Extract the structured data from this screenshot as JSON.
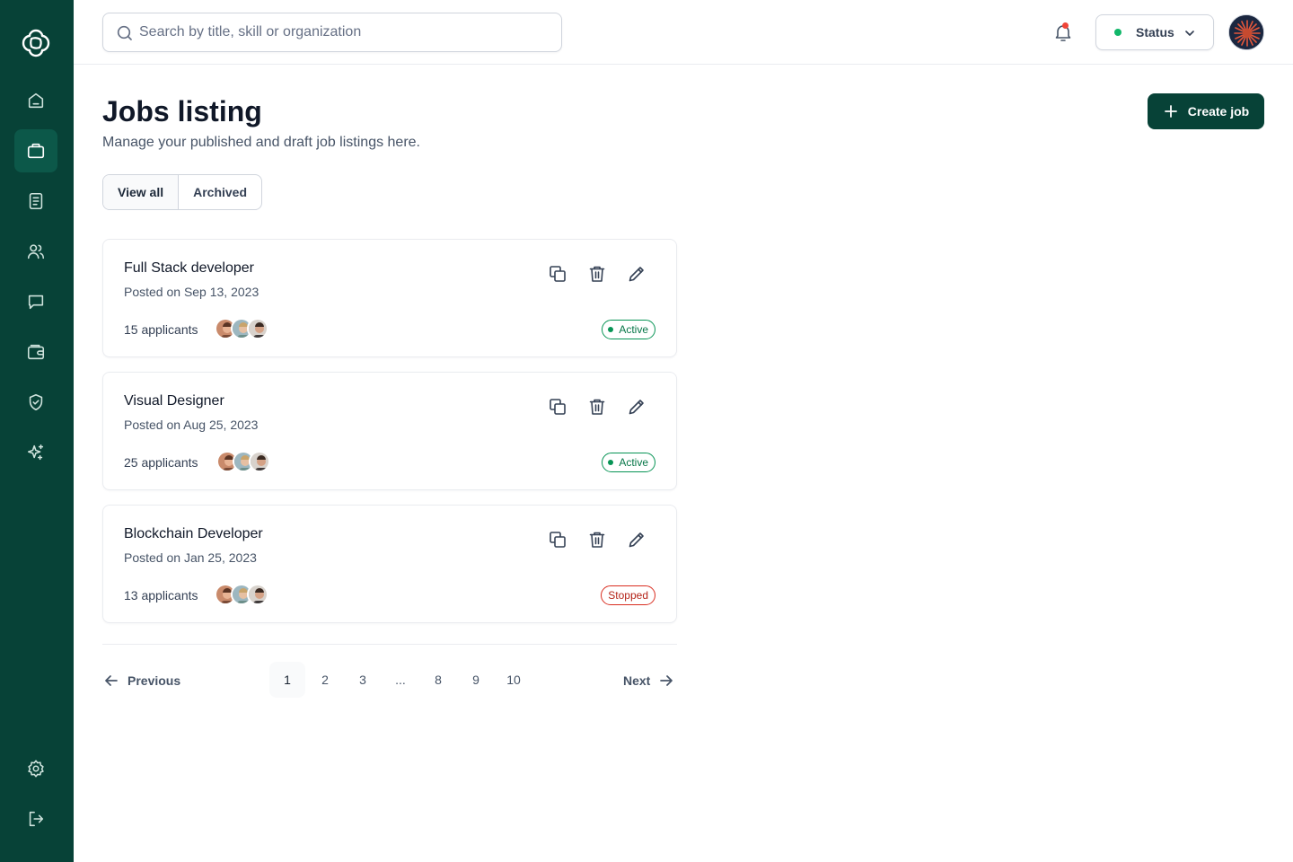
{
  "search": {
    "placeholder": "Search by title, skill or organization"
  },
  "header": {
    "status_label": "Status"
  },
  "page": {
    "title": "Jobs listing",
    "subtitle": "Manage your published and draft job listings here.",
    "create_label": "Create job"
  },
  "tabs": [
    {
      "label": "View all",
      "active": true
    },
    {
      "label": "Archived",
      "active": false
    }
  ],
  "jobs": [
    {
      "title": "Full Stack developer",
      "posted": "Posted on Sep 13, 2023",
      "applicants": "15 applicants",
      "status": "Active"
    },
    {
      "title": "Visual Designer",
      "posted": "Posted on Aug 25, 2023",
      "applicants": "25 applicants",
      "status": "Active"
    },
    {
      "title": "Blockchain Developer",
      "posted": "Posted on Jan 25, 2023",
      "applicants": "13 applicants",
      "status": "Stopped"
    }
  ],
  "pagination": {
    "previous": "Previous",
    "next": "Next",
    "pages": [
      "1",
      "2",
      "3",
      "...",
      "8",
      "9",
      "10"
    ],
    "current": "1"
  },
  "sidebar": {
    "items": [
      "home-icon",
      "briefcase-icon",
      "document-icon",
      "users-icon",
      "message-icon",
      "wallet-icon",
      "shield-check-icon",
      "sparkles-icon"
    ],
    "bottom": [
      "gear-icon",
      "logout-icon"
    ]
  },
  "colors": {
    "brand": "#074237",
    "active_status": "#079455",
    "stopped_status": "#d92d20",
    "notification": "#f04438"
  }
}
